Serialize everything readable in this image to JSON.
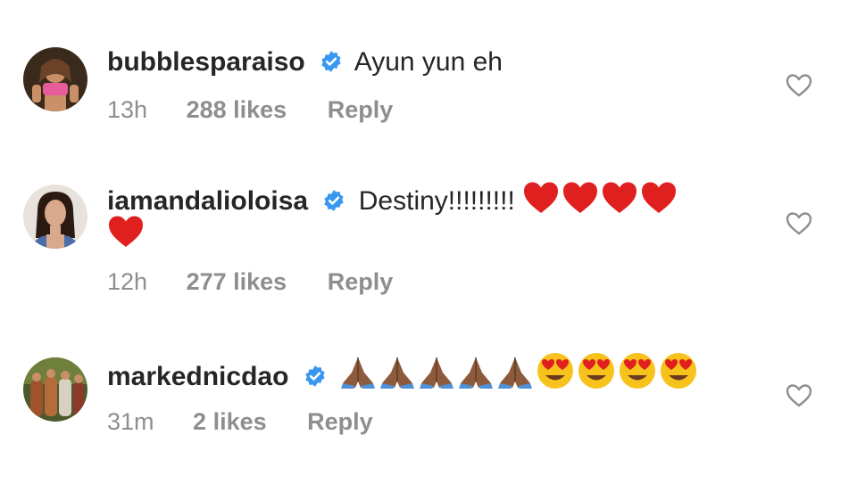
{
  "comments": [
    {
      "username": "bubblesparaiso",
      "verified": true,
      "text": "Ayun yun eh",
      "emojis": [],
      "time": "13h",
      "likes": "288 likes",
      "reply": "Reply",
      "avatar_icon": "avatar-photo-woman-pink-top"
    },
    {
      "username": "iamandalioloisa",
      "verified": true,
      "text": "Destiny!!!!!!!!!",
      "emojis": [
        "red-heart",
        "red-heart",
        "red-heart",
        "red-heart",
        "red-heart"
      ],
      "time": "12h",
      "likes": "277 likes",
      "reply": "Reply",
      "avatar_icon": "avatar-photo-woman-overalls"
    },
    {
      "username": "markednicdao",
      "verified": true,
      "text": "",
      "emojis": [
        "folded-hands",
        "folded-hands",
        "folded-hands",
        "folded-hands",
        "folded-hands",
        "heart-eyes",
        "heart-eyes",
        "heart-eyes",
        "heart-eyes"
      ],
      "time": "31m",
      "likes": "2 likes",
      "reply": "Reply",
      "avatar_icon": "avatar-photo-group-outdoors"
    }
  ],
  "colors": {
    "text": "#262626",
    "meta": "#8e8e8e",
    "verified_blue": "#3897f0",
    "heart_red": "#e0201e"
  }
}
